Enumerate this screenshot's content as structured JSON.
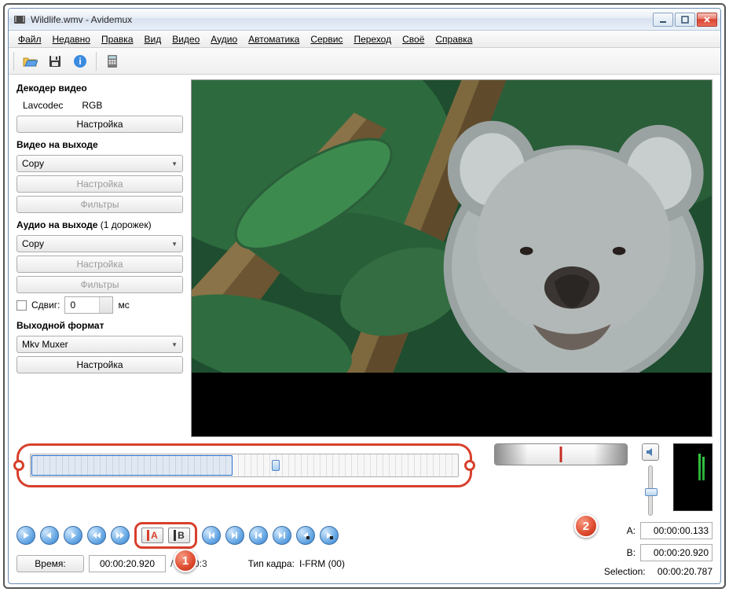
{
  "titlebar": {
    "title": "Wildlife.wmv - Avidemux"
  },
  "menu": [
    "Файл",
    "Недавно",
    "Правка",
    "Вид",
    "Видео",
    "Аудио",
    "Автоматика",
    "Сервис",
    "Переход",
    "Своё",
    "Справка"
  ],
  "decoder": {
    "heading": "Декодер видео",
    "codec": "Lavcodec",
    "cs": "RGB",
    "config": "Настройка"
  },
  "video_out": {
    "heading": "Видео на выходе",
    "codec": "Copy",
    "config": "Настройка",
    "filters": "Фильтры"
  },
  "audio_out": {
    "heading_prefix": "Аудио на выходе",
    "heading_suffix": "(1 дорожек)",
    "codec": "Copy",
    "config": "Настройка",
    "filters": "Фильтры",
    "shift_label": "Сдвиг:",
    "shift_value": "0",
    "shift_unit": "мс"
  },
  "format": {
    "heading": "Выходной формат",
    "container": "Mkv Muxer",
    "config": "Настройка"
  },
  "transport": {
    "time_btn": "Время:",
    "time_value": "00:00:20.920",
    "duration_fragment": "/ 00:00:3",
    "frame_type_label": "Тип кадра:",
    "frame_type_value": "I-FRM (00)"
  },
  "selection": {
    "a_label": "A:",
    "a_value": "00:00:00.133",
    "b_label": "B:",
    "b_value": "00:00:20.920",
    "sel_label": "Selection:",
    "sel_value": "00:00:20.787"
  },
  "callouts": {
    "one": "1",
    "two": "2"
  },
  "ab": {
    "a": "A",
    "b": "B"
  }
}
